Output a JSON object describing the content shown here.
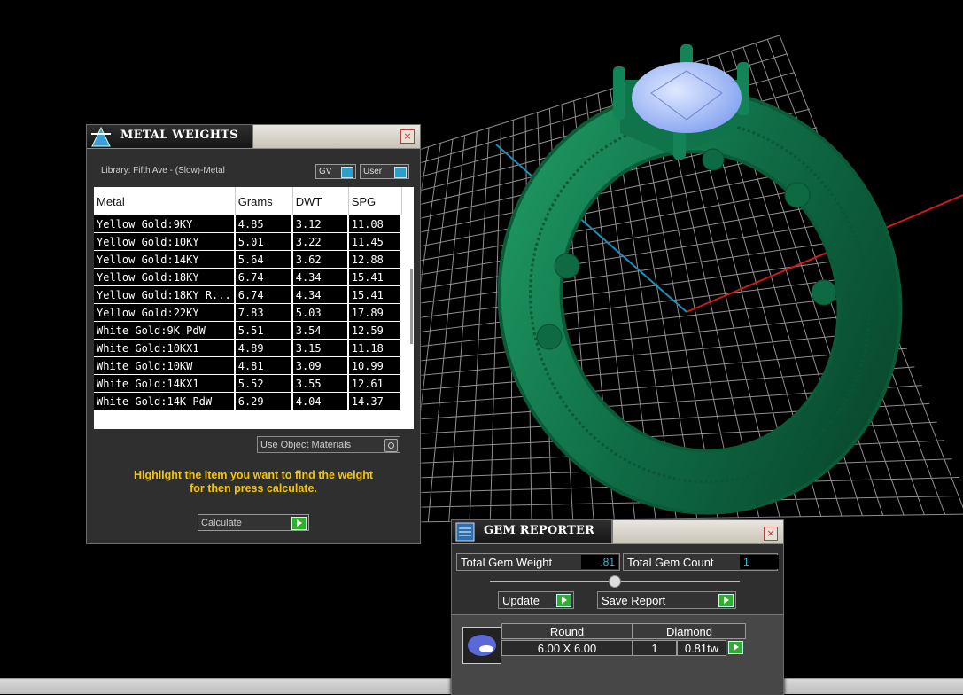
{
  "metal_weights": {
    "title": "METAL WEIGHTS",
    "close": "×",
    "library_label": "Library: Fifth Ave - (Slow)-Metal",
    "toggle_gv": "GV",
    "toggle_user": "User",
    "columns": [
      "Metal",
      "Grams",
      "DWT",
      "SPG"
    ],
    "rows": [
      {
        "metal": "Yellow Gold:9KY",
        "grams": "4.85",
        "dwt": "3.12",
        "spg": "11.08"
      },
      {
        "metal": "Yellow Gold:10KY",
        "grams": "5.01",
        "dwt": "3.22",
        "spg": "11.45"
      },
      {
        "metal": "Yellow Gold:14KY",
        "grams": "5.64",
        "dwt": "3.62",
        "spg": "12.88"
      },
      {
        "metal": "Yellow Gold:18KY",
        "grams": "6.74",
        "dwt": "4.34",
        "spg": "15.41"
      },
      {
        "metal": "Yellow Gold:18KY R...",
        "grams": "6.74",
        "dwt": "4.34",
        "spg": "15.41"
      },
      {
        "metal": "Yellow Gold:22KY",
        "grams": "7.83",
        "dwt": "5.03",
        "spg": "17.89"
      },
      {
        "metal": "White Gold:9K PdW",
        "grams": "5.51",
        "dwt": "3.54",
        "spg": "12.59"
      },
      {
        "metal": "White Gold:10KX1",
        "grams": "4.89",
        "dwt": "3.15",
        "spg": "11.18"
      },
      {
        "metal": "White Gold:10KW",
        "grams": "4.81",
        "dwt": "3.09",
        "spg": "10.99"
      },
      {
        "metal": "White Gold:14KX1",
        "grams": "5.52",
        "dwt": "3.55",
        "spg": "12.61"
      },
      {
        "metal": "White Gold:14K PdW",
        "grams": "6.29",
        "dwt": "4.04",
        "spg": "14.37"
      }
    ],
    "use_object_materials": "Use Object Materials",
    "hint_line1": "Highlight the item you want to find the weight",
    "hint_line2": "for then press calculate.",
    "calculate_label": "Calculate"
  },
  "gem_reporter": {
    "title": "GEM REPORTER",
    "close": "×",
    "total_weight_label": "Total Gem Weight",
    "total_weight_value": ".81",
    "total_count_label": "Total Gem Count",
    "total_count_value": "1",
    "update_label": "Update",
    "save_report_label": "Save Report",
    "gem": {
      "shape": "Round",
      "material": "Diamond",
      "size": "6.00 X 6.00",
      "count": "1",
      "total_weight": "0.81tw"
    }
  },
  "viewport": {
    "ring_color": "#0f6b45",
    "stone_color": "#a9c4ff",
    "grid_color": "#9a9a9a",
    "axis_x_color": "#d01818",
    "axis_y_color": "#1c8fb8"
  }
}
